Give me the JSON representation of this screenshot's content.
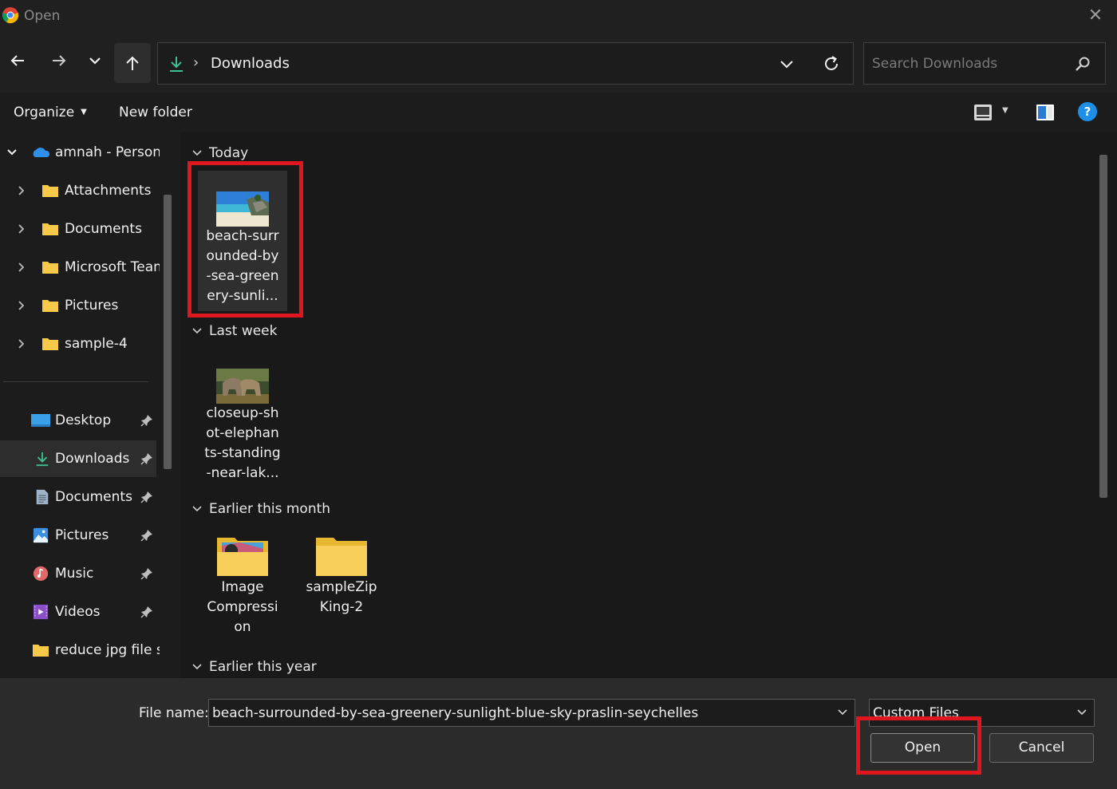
{
  "window": {
    "title": "Open",
    "close_glyph": "✕",
    "icon": "chrome-icon"
  },
  "nav": {
    "back_icon": "arrow-left-icon",
    "forward_icon": "arrow-right-icon",
    "recent_icon": "chevron-down-icon",
    "up_icon": "arrow-up-icon",
    "separator": "›",
    "current_folder": "Downloads",
    "search_placeholder": "Search Downloads"
  },
  "toolbar": {
    "organize_label": "Organize",
    "organize_caret": "▼",
    "new_folder_label": "New folder",
    "view_caret": "▼",
    "help_label": "?"
  },
  "sidebar": {
    "tree": [
      {
        "label": "amnah - Personal",
        "icon": "onedrive-cloud-icon",
        "expanded": true
      },
      {
        "label": "Attachments",
        "icon": "folder-icon"
      },
      {
        "label": "Documents",
        "icon": "folder-icon"
      },
      {
        "label": "Microsoft Teams",
        "icon": "folder-icon"
      },
      {
        "label": "Pictures",
        "icon": "folder-icon"
      },
      {
        "label": "sample-4",
        "icon": "folder-icon"
      }
    ],
    "quick_access": [
      {
        "label": "Desktop",
        "icon": "desktop-icon",
        "pinned": true
      },
      {
        "label": "Downloads",
        "icon": "download-icon",
        "pinned": true,
        "selected": true
      },
      {
        "label": "Documents",
        "icon": "document-icon",
        "pinned": true
      },
      {
        "label": "Pictures",
        "icon": "pictures-icon",
        "pinned": true
      },
      {
        "label": "Music",
        "icon": "music-icon",
        "pinned": true
      },
      {
        "label": "Videos",
        "icon": "videos-icon",
        "pinned": true
      },
      {
        "label": "reduce jpg file si",
        "icon": "folder-icon",
        "pinned": false
      }
    ]
  },
  "content": {
    "groups": [
      {
        "label": "Today",
        "items": [
          {
            "line1": "beach-surr",
            "line2": "ounded-by",
            "line3": "-sea-green",
            "line4": "ery-sunli...",
            "kind": "beach-image",
            "selected": true
          }
        ]
      },
      {
        "label": "Last week",
        "items": [
          {
            "line1": "closeup-sh",
            "line2": "ot-elephan",
            "line3": "ts-standing",
            "line4": "-near-lak...",
            "kind": "elephant-image"
          }
        ]
      },
      {
        "label": "Earlier this month",
        "items": [
          {
            "line1": "Image",
            "line2": "Compressi",
            "line3": "on",
            "kind": "image-folder"
          },
          {
            "line1": "sampleZip",
            "line2": "King-2",
            "kind": "folder"
          }
        ]
      },
      {
        "label": "Earlier this year",
        "items": []
      }
    ]
  },
  "footer": {
    "file_name_label": "File name:",
    "file_name_value": "beach-surrounded-by-sea-greenery-sunlight-blue-sky-praslin-seychelles",
    "file_type_value": "Custom Files",
    "open_label": "Open",
    "cancel_label": "Cancel"
  },
  "colors": {
    "highlight": "#e0161f",
    "accent": "#1e8fe6",
    "folder": "#f7c948"
  }
}
